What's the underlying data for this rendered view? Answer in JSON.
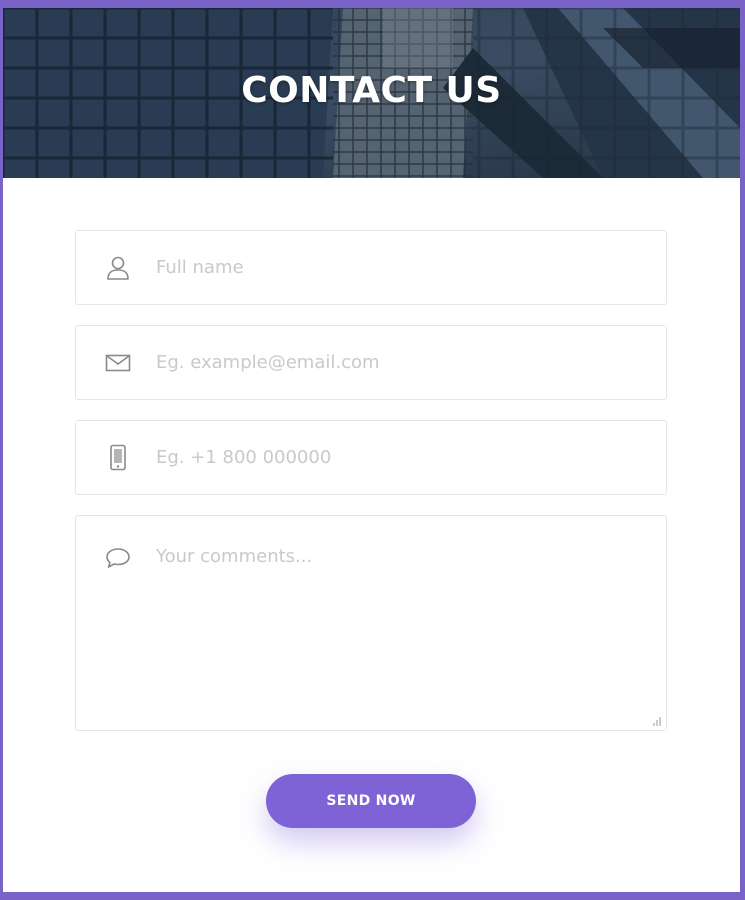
{
  "header": {
    "title": "CONTACT US"
  },
  "form": {
    "full_name": {
      "placeholder": "Full name",
      "value": "",
      "icon": "user-icon"
    },
    "email": {
      "placeholder": "Eg. example@email.com",
      "value": "",
      "icon": "envelope-icon"
    },
    "phone": {
      "placeholder": "Eg. +1 800 000000",
      "value": "",
      "icon": "mobile-phone-icon"
    },
    "comments": {
      "placeholder": "Your comments...",
      "value": "",
      "icon": "speech-bubble-icon"
    },
    "submit_label": "SEND NOW"
  },
  "colors": {
    "frame": "#7a63c8",
    "accent": "#7d63d6",
    "placeholder": "#c9c9c9",
    "field_border": "#e6e6e6"
  }
}
